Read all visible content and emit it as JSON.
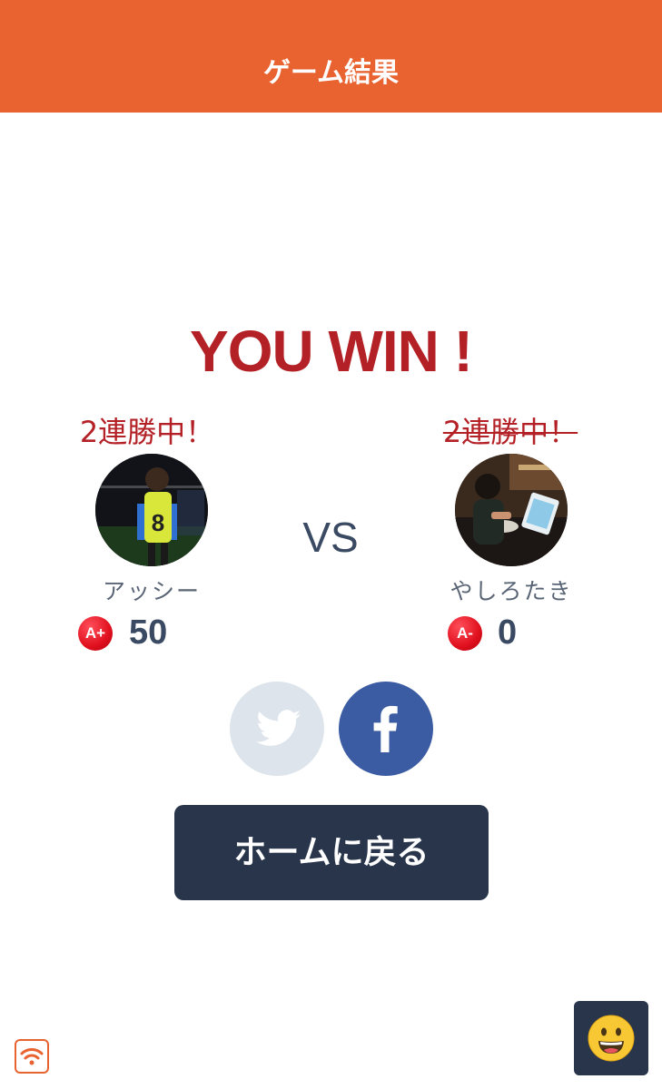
{
  "header": {
    "title": "ゲーム結果"
  },
  "result": {
    "title": "YOU WIN !"
  },
  "players": {
    "left": {
      "streak": "2連勝中！",
      "name": "アッシー",
      "rank": "A+",
      "points": "50"
    },
    "right": {
      "streak": "2連勝中！",
      "name": "やしろたき",
      "rank": "A-",
      "points": "0"
    }
  },
  "vs_label": "VS",
  "home_button": {
    "label": "ホームに戻る"
  },
  "colors": {
    "header": "#e96330",
    "win_red": "#b32025",
    "dark_navy": "#28354a",
    "facebook_blue": "#3b5ca2",
    "twitter_disabled": "#dde4eb"
  },
  "icons": {
    "twitter": "twitter-bird-icon",
    "facebook": "facebook-f-icon",
    "wifi": "wifi-icon",
    "chat": "smiley-face-icon"
  }
}
